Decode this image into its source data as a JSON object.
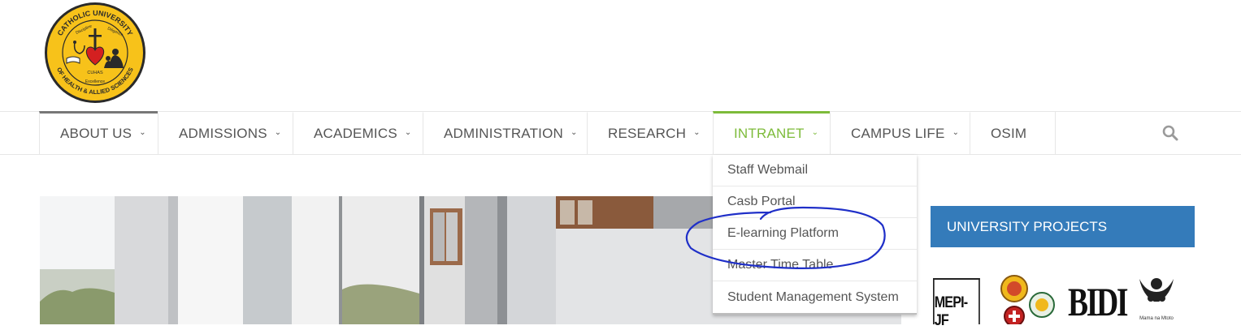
{
  "logo": {
    "top_text": "CATHOLIC UNIVERSITY",
    "bottom_text": "OF HEALTH & ALLIED SCIENCES",
    "left_motto": "Discipline",
    "right_motto": "Diligence",
    "bottom_motto": "Excellence",
    "acronym": "CUHAS"
  },
  "nav": {
    "items": [
      {
        "label": "ABOUT US"
      },
      {
        "label": "ADMISSIONS"
      },
      {
        "label": "ACADEMICS"
      },
      {
        "label": "ADMINISTRATION"
      },
      {
        "label": "RESEARCH"
      },
      {
        "label": "INTRANET"
      },
      {
        "label": "CAMPUS LIFE"
      },
      {
        "label": "OSIM"
      }
    ],
    "active": "INTRANET",
    "chevron": "⌄",
    "search_icon": "search-icon"
  },
  "dropdown": {
    "items": [
      {
        "label": "Staff Webmail"
      },
      {
        "label": "Casb Portal"
      },
      {
        "label": "E-learning Platform"
      },
      {
        "label": "Master Time Table"
      },
      {
        "label": "Student Management System"
      }
    ]
  },
  "sidebar": {
    "projects_title": "UNIVERSITY PROJECTS",
    "logos": {
      "mepi": "MEPI-JF",
      "bidi": "BIDI",
      "mama": "Mama na Mtoto"
    }
  },
  "colors": {
    "accent": "#7dbb3a",
    "projects_bg": "#347bba",
    "annotation": "#1f2fc8",
    "logo_yellow": "#f7c21a"
  }
}
